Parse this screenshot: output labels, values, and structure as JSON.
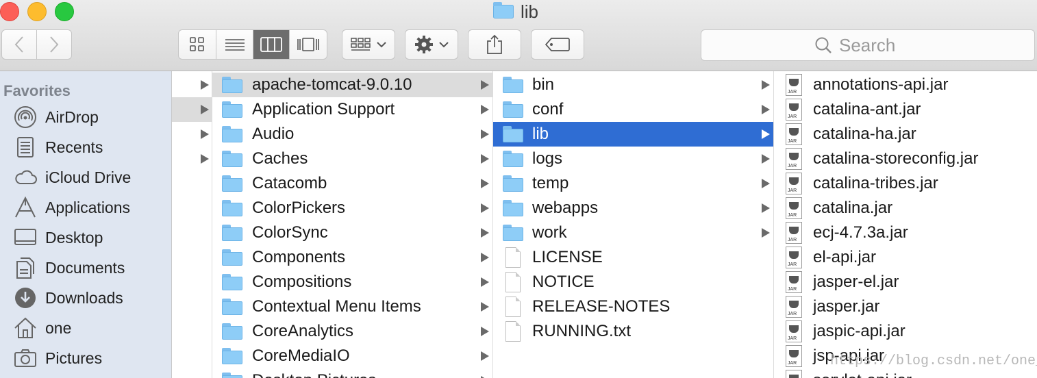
{
  "window": {
    "title": "lib"
  },
  "toolbar": {
    "search_placeholder": "Search"
  },
  "sidebar": {
    "heading": "Favorites",
    "items": [
      {
        "label": "AirDrop",
        "icon": "airdrop-icon"
      },
      {
        "label": "Recents",
        "icon": "recents-icon"
      },
      {
        "label": "iCloud Drive",
        "icon": "cloud-icon"
      },
      {
        "label": "Applications",
        "icon": "applications-icon"
      },
      {
        "label": "Desktop",
        "icon": "desktop-icon"
      },
      {
        "label": "Documents",
        "icon": "documents-icon"
      },
      {
        "label": "Downloads",
        "icon": "downloads-icon"
      },
      {
        "label": "one",
        "icon": "home-icon"
      },
      {
        "label": "Pictures",
        "icon": "camera-icon"
      }
    ]
  },
  "column2": [
    "apache-tomcat-9.0.10",
    "Application Support",
    "Audio",
    "Caches",
    "Catacomb",
    "ColorPickers",
    "ColorSync",
    "Components",
    "Compositions",
    "Contextual Menu Items",
    "CoreAnalytics",
    "CoreMediaIO",
    "Desktop Pictures"
  ],
  "column3": [
    {
      "name": "bin",
      "kind": "folder"
    },
    {
      "name": "conf",
      "kind": "folder"
    },
    {
      "name": "lib",
      "kind": "folder"
    },
    {
      "name": "logs",
      "kind": "folder"
    },
    {
      "name": "temp",
      "kind": "folder"
    },
    {
      "name": "webapps",
      "kind": "folder"
    },
    {
      "name": "work",
      "kind": "folder"
    },
    {
      "name": "LICENSE",
      "kind": "file"
    },
    {
      "name": "NOTICE",
      "kind": "file"
    },
    {
      "name": "RELEASE-NOTES",
      "kind": "file"
    },
    {
      "name": "RUNNING.txt",
      "kind": "file"
    }
  ],
  "column4": [
    "annotations-api.jar",
    "catalina-ant.jar",
    "catalina-ha.jar",
    "catalina-storeconfig.jar",
    "catalina-tribes.jar",
    "catalina.jar",
    "ecj-4.7.3a.jar",
    "el-api.jar",
    "jasper-el.jar",
    "jasper.jar",
    "jaspic-api.jar",
    "jsp-api.jar",
    "servlet-api.jar"
  ],
  "jar_label": "JAR",
  "watermark": "https://blog.csdn.net/one_hwx"
}
